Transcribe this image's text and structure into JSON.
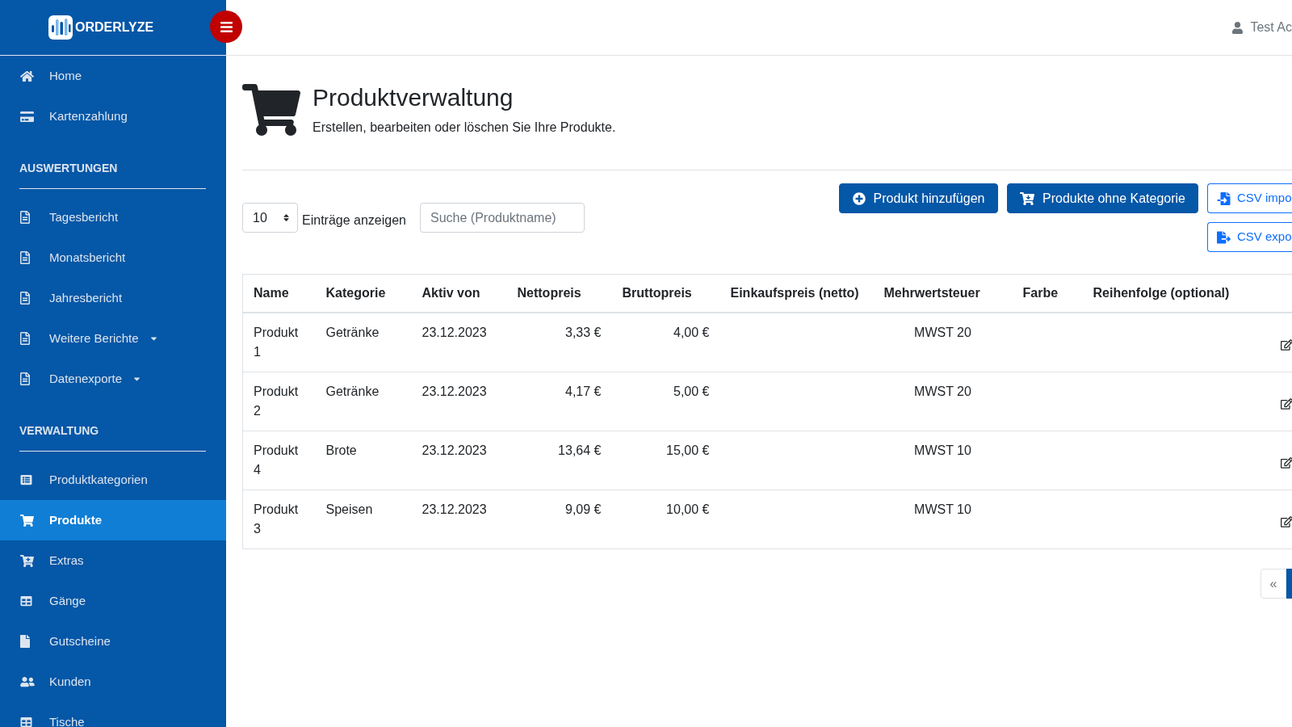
{
  "sidebar": {
    "brand": "ORDERLYZE",
    "sections": [
      {
        "items": [
          {
            "label": "Home",
            "selected": false,
            "dropdown": false
          },
          {
            "label": "Kartenzahlung",
            "selected": false,
            "dropdown": false
          }
        ]
      },
      {
        "title": "AUSWERTUNGEN",
        "items": [
          {
            "label": "Tagesbericht",
            "selected": false,
            "dropdown": false
          },
          {
            "label": "Monatsbericht",
            "selected": false,
            "dropdown": false
          },
          {
            "label": "Jahresbericht",
            "selected": false,
            "dropdown": false
          },
          {
            "label": "Weitere Berichte",
            "selected": false,
            "dropdown": true
          },
          {
            "label": "Datenexporte",
            "selected": false,
            "dropdown": true
          }
        ]
      },
      {
        "title": "VERWALTUNG",
        "items": [
          {
            "label": "Produktkategorien",
            "selected": false,
            "dropdown": false
          },
          {
            "label": "Produkte",
            "selected": true,
            "dropdown": false
          },
          {
            "label": "Extras",
            "selected": false,
            "dropdown": false
          },
          {
            "label": "Gänge",
            "selected": false,
            "dropdown": false
          },
          {
            "label": "Gutscheine",
            "selected": false,
            "dropdown": false
          },
          {
            "label": "Kunden",
            "selected": false,
            "dropdown": false
          },
          {
            "label": "Tische",
            "selected": false,
            "dropdown": false
          }
        ]
      }
    ]
  },
  "top_bar": {
    "user_name": "Test Ac"
  },
  "page_header": {
    "title": "Produktverwaltung",
    "subtitle": "Erstellen, bearbeiten oder löschen Sie Ihre Produkte."
  },
  "toolbar": {
    "page_size": "10",
    "page_size_label": "Einträge anzeigen",
    "search": {
      "placeholder": "Suche (Produktname)"
    },
    "buttons": [
      {
        "label": "Produkt hinzufügen",
        "kind": "primary"
      },
      {
        "label": "Produkte ohne Kategorie",
        "kind": "primary"
      },
      {
        "label": "CSV impo",
        "kind": "outline"
      },
      {
        "label": "CSV expo",
        "kind": "outline"
      }
    ]
  },
  "table": {
    "columns": [
      "Name",
      "Kategorie",
      "Aktiv von",
      "Nettopreis",
      "Bruttopreis",
      "Einkaufspreis (netto)",
      "Mehrwertsteuer",
      "Farbe",
      "Reihenfolge (optional)"
    ],
    "rows": [
      {
        "name": "Produkt 1",
        "category": "Getränke",
        "active_from": "23.12.2023",
        "net_price": "3,33 €",
        "gross_price": "4,00 €",
        "vat": "MWST 20"
      },
      {
        "name": "Produkt 2",
        "category": "Getränke",
        "active_from": "23.12.2023",
        "net_price": "4,17 €",
        "gross_price": "5,00 €",
        "vat": "MWST 20"
      },
      {
        "name": "Produkt 4",
        "category": "Brote",
        "active_from": "23.12.2023",
        "net_price": "13,64 €",
        "gross_price": "15,00 €",
        "vat": "MWST 10"
      },
      {
        "name": "Produkt 3",
        "category": "Speisen",
        "active_from": "23.12.2023",
        "net_price": "9,09 €",
        "gross_price": "10,00 €",
        "vat": "MWST 10"
      }
    ]
  },
  "pagination": {
    "previous": "«"
  }
}
